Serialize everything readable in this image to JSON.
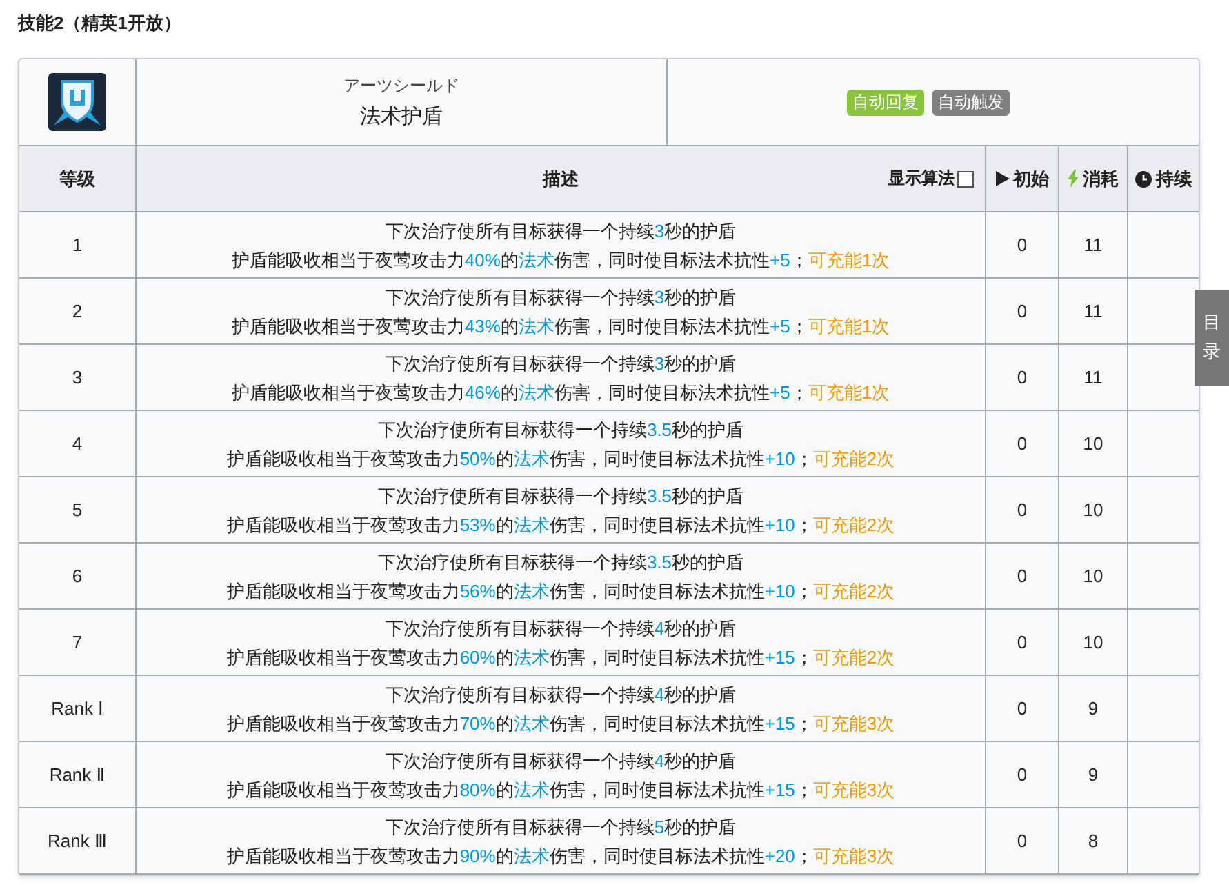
{
  "section_title": "技能2（精英1开放）",
  "skill": {
    "name_jp": "アーツシールド",
    "name": "法术护盾",
    "tags": [
      {
        "label": "自动回复",
        "color": "#8ac33c"
      },
      {
        "label": "自动触发",
        "color": "#808080"
      }
    ]
  },
  "table": {
    "columns": [
      {
        "label": "等级"
      },
      {
        "label": "描述",
        "toggle": {
          "label": "显示算法",
          "checked": false
        }
      },
      {
        "label": "初始",
        "kind": "play"
      },
      {
        "label": "消耗",
        "kind": "bolt"
      },
      {
        "label": "持续",
        "kind": "clock"
      }
    ],
    "rows": [
      {
        "level": "1",
        "line1": [
          {
            "kind": "plain",
            "text": "下次治疗使所有目标获得一个持续"
          },
          {
            "kind": "value",
            "text": "3"
          },
          {
            "kind": "plain",
            "text": "秒的护盾"
          }
        ],
        "line2": [
          {
            "kind": "plain",
            "text": "护盾能吸收相当于夜莺攻击力"
          },
          {
            "kind": "value",
            "text": "40%"
          },
          {
            "kind": "plain",
            "text": "的"
          },
          {
            "kind": "value",
            "text": "法术"
          },
          {
            "kind": "plain",
            "text": "伤害，同时使目标法术抗性"
          },
          {
            "kind": "value",
            "text": "+5"
          },
          {
            "kind": "plain",
            "text": "；"
          },
          {
            "kind": "charge",
            "text": "可充能1次"
          }
        ],
        "initial": "0",
        "cost": "11"
      },
      {
        "level": "2",
        "line1": [
          {
            "kind": "plain",
            "text": "下次治疗使所有目标获得一个持续"
          },
          {
            "kind": "value",
            "text": "3"
          },
          {
            "kind": "plain",
            "text": "秒的护盾"
          }
        ],
        "line2": [
          {
            "kind": "plain",
            "text": "护盾能吸收相当于夜莺攻击力"
          },
          {
            "kind": "value",
            "text": "43%"
          },
          {
            "kind": "plain",
            "text": "的"
          },
          {
            "kind": "value",
            "text": "法术"
          },
          {
            "kind": "plain",
            "text": "伤害，同时使目标法术抗性"
          },
          {
            "kind": "value",
            "text": "+5"
          },
          {
            "kind": "plain",
            "text": "；"
          },
          {
            "kind": "charge",
            "text": "可充能1次"
          }
        ],
        "initial": "0",
        "cost": "11"
      },
      {
        "level": "3",
        "line1": [
          {
            "kind": "plain",
            "text": "下次治疗使所有目标获得一个持续"
          },
          {
            "kind": "value",
            "text": "3"
          },
          {
            "kind": "plain",
            "text": "秒的护盾"
          }
        ],
        "line2": [
          {
            "kind": "plain",
            "text": "护盾能吸收相当于夜莺攻击力"
          },
          {
            "kind": "value",
            "text": "46%"
          },
          {
            "kind": "plain",
            "text": "的"
          },
          {
            "kind": "value",
            "text": "法术"
          },
          {
            "kind": "plain",
            "text": "伤害，同时使目标法术抗性"
          },
          {
            "kind": "value",
            "text": "+5"
          },
          {
            "kind": "plain",
            "text": "；"
          },
          {
            "kind": "charge",
            "text": "可充能1次"
          }
        ],
        "initial": "0",
        "cost": "11"
      },
      {
        "level": "4",
        "line1": [
          {
            "kind": "plain",
            "text": "下次治疗使所有目标获得一个持续"
          },
          {
            "kind": "value",
            "text": "3.5"
          },
          {
            "kind": "plain",
            "text": "秒的护盾"
          }
        ],
        "line2": [
          {
            "kind": "plain",
            "text": "护盾能吸收相当于夜莺攻击力"
          },
          {
            "kind": "value",
            "text": "50%"
          },
          {
            "kind": "plain",
            "text": "的"
          },
          {
            "kind": "value",
            "text": "法术"
          },
          {
            "kind": "plain",
            "text": "伤害，同时使目标法术抗性"
          },
          {
            "kind": "value",
            "text": "+10"
          },
          {
            "kind": "plain",
            "text": "；"
          },
          {
            "kind": "charge",
            "text": "可充能2次"
          }
        ],
        "initial": "0",
        "cost": "10"
      },
      {
        "level": "5",
        "line1": [
          {
            "kind": "plain",
            "text": "下次治疗使所有目标获得一个持续"
          },
          {
            "kind": "value",
            "text": "3.5"
          },
          {
            "kind": "plain",
            "text": "秒的护盾"
          }
        ],
        "line2": [
          {
            "kind": "plain",
            "text": "护盾能吸收相当于夜莺攻击力"
          },
          {
            "kind": "value",
            "text": "53%"
          },
          {
            "kind": "plain",
            "text": "的"
          },
          {
            "kind": "value",
            "text": "法术"
          },
          {
            "kind": "plain",
            "text": "伤害，同时使目标法术抗性"
          },
          {
            "kind": "value",
            "text": "+10"
          },
          {
            "kind": "plain",
            "text": "；"
          },
          {
            "kind": "charge",
            "text": "可充能2次"
          }
        ],
        "initial": "0",
        "cost": "10"
      },
      {
        "level": "6",
        "line1": [
          {
            "kind": "plain",
            "text": "下次治疗使所有目标获得一个持续"
          },
          {
            "kind": "value",
            "text": "3.5"
          },
          {
            "kind": "plain",
            "text": "秒的护盾"
          }
        ],
        "line2": [
          {
            "kind": "plain",
            "text": "护盾能吸收相当于夜莺攻击力"
          },
          {
            "kind": "value",
            "text": "56%"
          },
          {
            "kind": "plain",
            "text": "的"
          },
          {
            "kind": "value",
            "text": "法术"
          },
          {
            "kind": "plain",
            "text": "伤害，同时使目标法术抗性"
          },
          {
            "kind": "value",
            "text": "+10"
          },
          {
            "kind": "plain",
            "text": "；"
          },
          {
            "kind": "charge",
            "text": "可充能2次"
          }
        ],
        "initial": "0",
        "cost": "10"
      },
      {
        "level": "7",
        "line1": [
          {
            "kind": "plain",
            "text": "下次治疗使所有目标获得一个持续"
          },
          {
            "kind": "value",
            "text": "4"
          },
          {
            "kind": "plain",
            "text": "秒的护盾"
          }
        ],
        "line2": [
          {
            "kind": "plain",
            "text": "护盾能吸收相当于夜莺攻击力"
          },
          {
            "kind": "value",
            "text": "60%"
          },
          {
            "kind": "plain",
            "text": "的"
          },
          {
            "kind": "value",
            "text": "法术"
          },
          {
            "kind": "plain",
            "text": "伤害，同时使目标法术抗性"
          },
          {
            "kind": "value",
            "text": "+15"
          },
          {
            "kind": "plain",
            "text": "；"
          },
          {
            "kind": "charge",
            "text": "可充能2次"
          }
        ],
        "initial": "0",
        "cost": "10"
      },
      {
        "level": "Rank Ⅰ",
        "line1": [
          {
            "kind": "plain",
            "text": "下次治疗使所有目标获得一个持续"
          },
          {
            "kind": "value",
            "text": "4"
          },
          {
            "kind": "plain",
            "text": "秒的护盾"
          }
        ],
        "line2": [
          {
            "kind": "plain",
            "text": "护盾能吸收相当于夜莺攻击力"
          },
          {
            "kind": "value",
            "text": "70%"
          },
          {
            "kind": "plain",
            "text": "的"
          },
          {
            "kind": "value",
            "text": "法术"
          },
          {
            "kind": "plain",
            "text": "伤害，同时使目标法术抗性"
          },
          {
            "kind": "value",
            "text": "+15"
          },
          {
            "kind": "plain",
            "text": "；"
          },
          {
            "kind": "charge",
            "text": "可充能3次"
          }
        ],
        "initial": "0",
        "cost": "9"
      },
      {
        "level": "Rank Ⅱ",
        "line1": [
          {
            "kind": "plain",
            "text": "下次治疗使所有目标获得一个持续"
          },
          {
            "kind": "value",
            "text": "4"
          },
          {
            "kind": "plain",
            "text": "秒的护盾"
          }
        ],
        "line2": [
          {
            "kind": "plain",
            "text": "护盾能吸收相当于夜莺攻击力"
          },
          {
            "kind": "value",
            "text": "80%"
          },
          {
            "kind": "plain",
            "text": "的"
          },
          {
            "kind": "value",
            "text": "法术"
          },
          {
            "kind": "plain",
            "text": "伤害，同时使目标法术抗性"
          },
          {
            "kind": "value",
            "text": "+15"
          },
          {
            "kind": "plain",
            "text": "；"
          },
          {
            "kind": "charge",
            "text": "可充能3次"
          }
        ],
        "initial": "0",
        "cost": "9"
      },
      {
        "level": "Rank Ⅲ",
        "line1": [
          {
            "kind": "plain",
            "text": "下次治疗使所有目标获得一个持续"
          },
          {
            "kind": "value",
            "text": "5"
          },
          {
            "kind": "plain",
            "text": "秒的护盾"
          }
        ],
        "line2": [
          {
            "kind": "plain",
            "text": "护盾能吸收相当于夜莺攻击力"
          },
          {
            "kind": "value",
            "text": "90%"
          },
          {
            "kind": "plain",
            "text": "的"
          },
          {
            "kind": "value",
            "text": "法术"
          },
          {
            "kind": "plain",
            "text": "伤害，同时使目标法术抗性"
          },
          {
            "kind": "value",
            "text": "+20"
          },
          {
            "kind": "plain",
            "text": "；"
          },
          {
            "kind": "charge",
            "text": "可充能3次"
          }
        ],
        "initial": "0",
        "cost": "8"
      }
    ]
  },
  "side_tab": "目录"
}
